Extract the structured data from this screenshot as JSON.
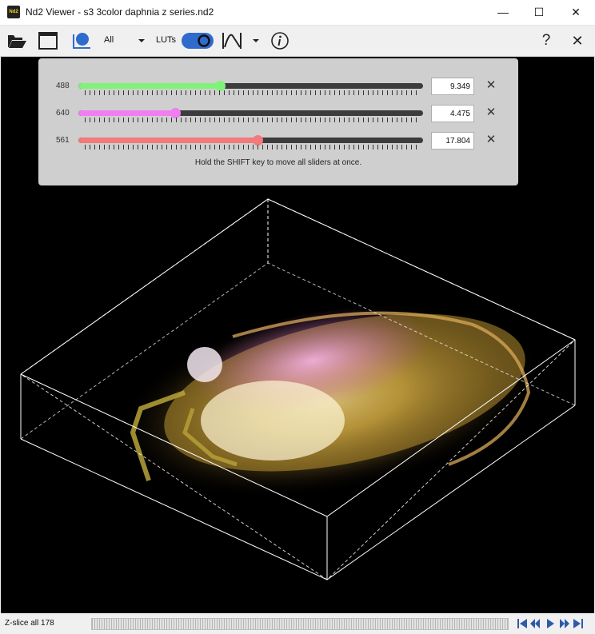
{
  "window": {
    "app_icon_text": "Nd2",
    "title": "Nd2 Viewer - s3 3color daphnia z series.nd2",
    "min_glyph": "—",
    "max_glyph": "☐",
    "close_glyph": "✕"
  },
  "toolbar": {
    "channel_select_value": "All",
    "luts_label": "LUTs",
    "help_glyph": "?",
    "close_glyph": "✕"
  },
  "lut_panel": {
    "channels": [
      {
        "name": "488",
        "value": "9.349",
        "position": 0.41,
        "color": "#7ff27a"
      },
      {
        "name": "640",
        "value": "4.475",
        "position": 0.28,
        "color": "#f07ef0"
      },
      {
        "name": "561",
        "value": "17.804",
        "position": 0.52,
        "color": "#f27a7a"
      }
    ],
    "clear_glyph": "✕",
    "hint": "Hold the SHIFT key to move all sliders at once."
  },
  "status": {
    "z_label": "Z-slice all 178"
  },
  "colors": {
    "accent": "#2f6bcc",
    "toggle": "#2f6bcc",
    "playback": "#2f5aa8",
    "box": "#ffffff"
  }
}
